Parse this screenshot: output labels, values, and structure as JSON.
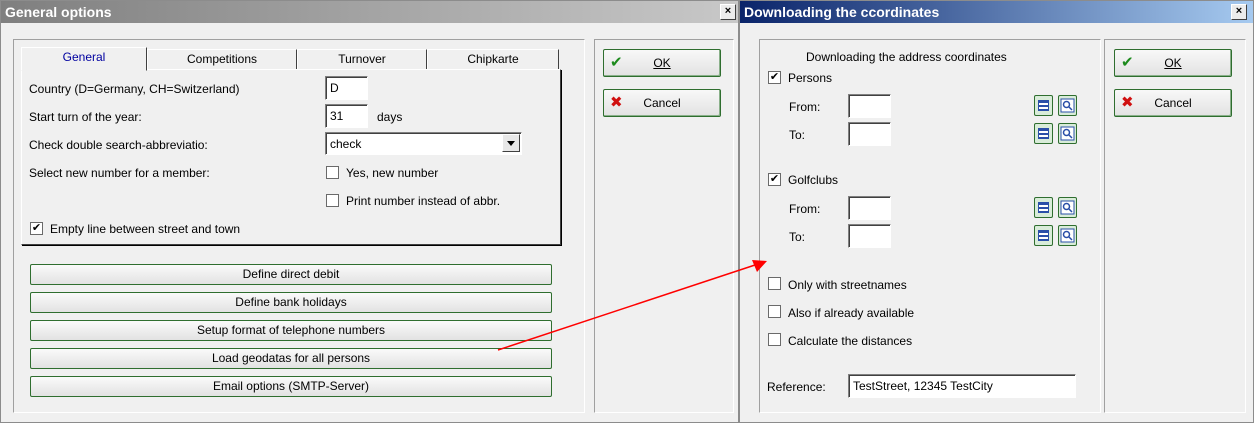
{
  "win1": {
    "title": "General options",
    "close": "×",
    "tabs": [
      "General",
      "Competitions",
      "Turnover",
      "Chipkarte"
    ],
    "country_label": "Country (D=Germany, CH=Switzerland)",
    "country_value": "D",
    "start_label": "Start turn of the year:",
    "start_value": "31",
    "start_unit": "days",
    "double_label": "Check double search-abbreviatio:",
    "double_value": "check",
    "newnum_label": "Select new number for a member:",
    "yes_new": "Yes, new number",
    "print_num": "Print number instead of abbr.",
    "empty_line": "Empty line between street and town",
    "buttons": [
      "Define direct debit",
      "Define bank holidays",
      "Setup format of telephone numbers",
      "Load geodatas for all persons",
      "Email options (SMTP-Server)"
    ],
    "ok": "OK",
    "cancel": "Cancel"
  },
  "win2": {
    "title": "Downloading the ccordinates",
    "close": "×",
    "heading": "Downloading the address coordinates",
    "persons": "Persons",
    "from": "From:",
    "to": "To:",
    "golfclubs": "Golfclubs",
    "only_streets": "Only with streetnames",
    "also_available": "Also if already available",
    "calc_dist": "Calculate the distances",
    "reference_label": "Reference:",
    "reference_value": "TestStreet, 12345 TestCity",
    "ok": "OK",
    "cancel": "Cancel"
  },
  "colors": {
    "arrow": "#ff0000",
    "active_title": "#0a246a",
    "button_border": "#2f6e2f"
  }
}
